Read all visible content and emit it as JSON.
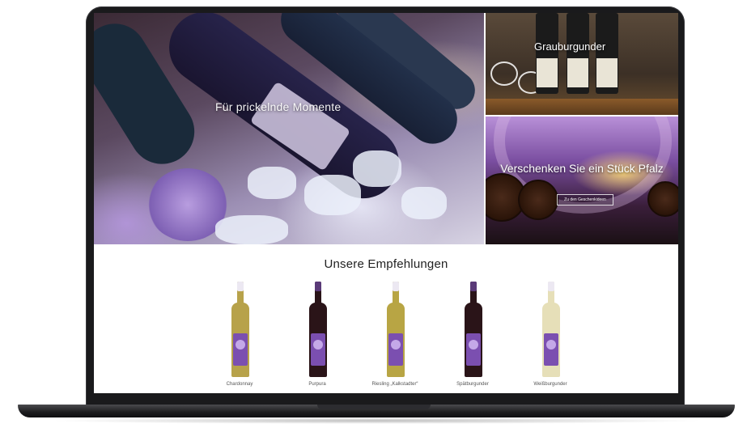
{
  "hero": {
    "main_text": "Für prickelnde Momente",
    "top_right_text": "Grauburgunder",
    "bottom_right_text": "Verschenken Sie ein Stück Pfalz",
    "bottom_right_button": "Zu den Geschenkideen"
  },
  "recommendations": {
    "title": "Unsere Empfehlungen",
    "products": [
      {
        "name": "Chardonnay",
        "wine_color": "#b7a24a"
      },
      {
        "name": "Purpura",
        "wine_color": "#2a1418"
      },
      {
        "name": "Riesling „Kalkstadter“",
        "wine_color": "#b8a544"
      },
      {
        "name": "Spätburgunder",
        "wine_color": "#2a1418"
      },
      {
        "name": "Weißburgunder",
        "wine_color": "#e6dfb8"
      }
    ]
  },
  "colors": {
    "brand_purple": "#7b4fb0",
    "laptop_frame": "#1a1a1c"
  }
}
